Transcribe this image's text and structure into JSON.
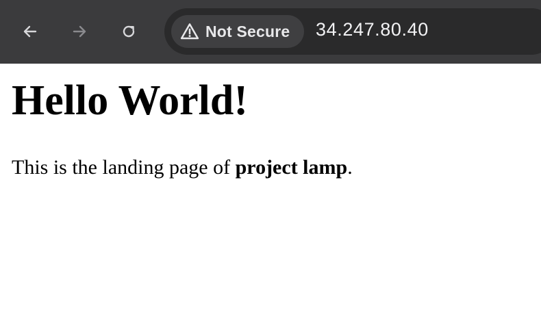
{
  "browser": {
    "nav": {
      "back_icon": "arrow-left-icon",
      "forward_icon": "arrow-right-icon",
      "reload_icon": "reload-icon"
    },
    "address_bar": {
      "security_icon": "warning-triangle-icon",
      "security_label": "Not Secure",
      "url": "34.247.80.40"
    },
    "colors": {
      "toolbar": "#3b3b3d",
      "omnibox": "#2a2a2b",
      "chip": "#3f3f41"
    }
  },
  "page": {
    "heading": "Hello World!",
    "paragraph_prefix": "This is the landing page of ",
    "paragraph_bold": "project lamp",
    "paragraph_suffix": "."
  }
}
